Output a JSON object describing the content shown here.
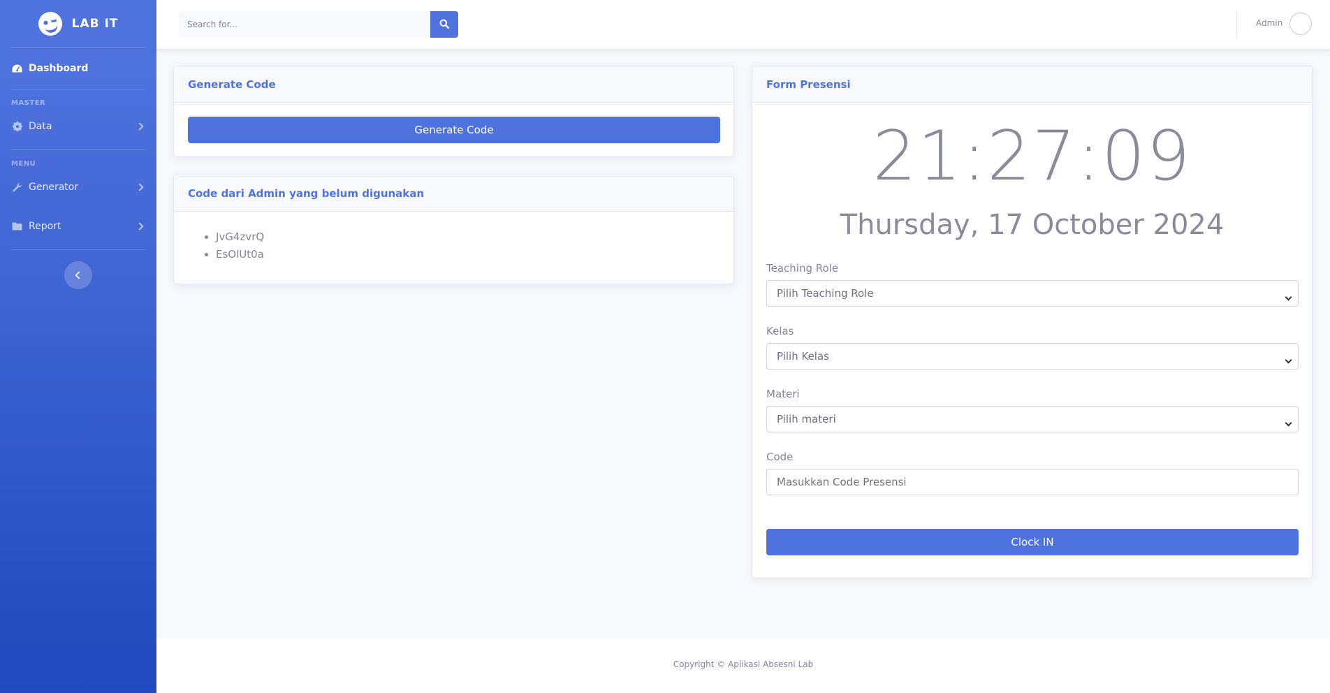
{
  "sidebar": {
    "brand": "LAB IT",
    "dashboard": "Dashboard",
    "heading_master": "MASTER",
    "data": "Data",
    "heading_menu": "MENU",
    "generator": "Generator",
    "report": "Report"
  },
  "topbar": {
    "search_placeholder": "Search for...",
    "user_name": "Admin"
  },
  "generate_card": {
    "title": "Generate Code",
    "button": "Generate Code"
  },
  "codes_card": {
    "title": "Code dari Admin yang belum digunakan",
    "codes": [
      "JvG4zvrQ",
      "EsOlUt0a"
    ]
  },
  "form": {
    "title": "Form Presensi",
    "time": "21:27:09",
    "date": "Thursday, 17 October 2024",
    "teaching_role_label": "Teaching Role",
    "teaching_role_value": "Pilih Teaching Role",
    "kelas_label": "Kelas",
    "kelas_value": "Pilih Kelas",
    "materi_label": "Materi",
    "materi_value": "Pilih materi",
    "code_label": "Code",
    "code_placeholder": "Masukkan Code Presensi",
    "submit": "Clock IN"
  },
  "footer": {
    "copyright": "Copyright © Aplikasi Absesni Lab"
  },
  "colors": {
    "primary": "#4e73df",
    "sidebar_bottom": "#224abe",
    "background": "#f8f9fc",
    "text": "#858796"
  }
}
